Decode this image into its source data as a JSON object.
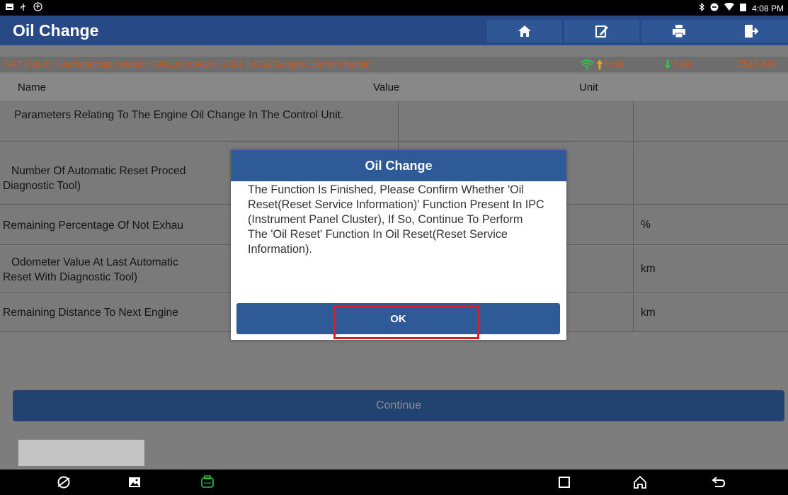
{
  "status_bar": {
    "time": "4:08 PM",
    "left_icons": [
      "notification-icon",
      "usb-icon",
      "accessibility-icon"
    ],
    "right_icons": [
      "bluetooth-icon",
      "dnd-icon",
      "wifi-icon",
      "battery-icon"
    ]
  },
  "header": {
    "title": "Oil Change",
    "buttons": [
      "home-icon",
      "edit-report-icon",
      "print-icon",
      "exit-icon"
    ]
  },
  "breadcrumb": {
    "text": "FIAT V38.30 > Automatically Search > DUCATO MCA > 2021 > ECM (Engine Control Module)",
    "upload": "0 b/s",
    "download": "0 b/s",
    "voltage": "12.41V"
  },
  "table": {
    "columns": [
      "Name",
      "Value",
      "Unit"
    ],
    "rows": [
      {
        "name": "Parameters Relating To The Engine Oil Change In The Control Unit.",
        "value": "",
        "unit": ""
      },
      {
        "name": "Number Of Automatic Reset Proced",
        "name_line2": "Diagnostic Tool)",
        "value": "",
        "unit": ""
      },
      {
        "name": "Remaining Percentage Of Not Exhau",
        "value": "",
        "unit": "%"
      },
      {
        "name": "Odometer Value At Last Automatic",
        "name_line2": "Reset With Diagnostic Tool)",
        "value": "",
        "unit": "km"
      },
      {
        "name": "Remaining Distance To Next Engine",
        "value": "",
        "unit": "km"
      }
    ]
  },
  "continue_label": "Continue",
  "dialog": {
    "title": "Oil Change",
    "message": "The Function Is Finished, Please Confirm Whether 'Oil Reset(Reset Service Information)' Function Present In IPC (Instrument Panel Cluster), If So, Continue To Perform The 'Oil Reset' Function In Oil Reset(Reset Service Information).",
    "ok_label": "OK"
  },
  "colors": {
    "header_blue": "#274a86",
    "dialog_blue": "#2e5a97",
    "breadcrumb_orange": "#d5581a",
    "highlight_red": "#d81e2a"
  }
}
